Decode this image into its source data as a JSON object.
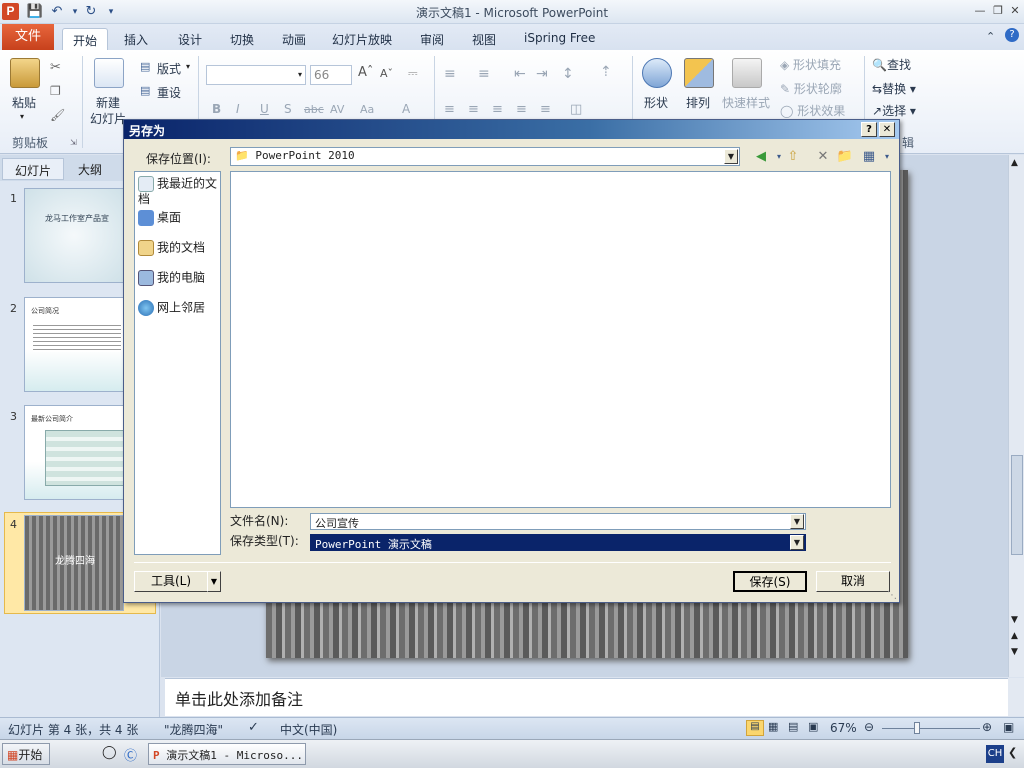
{
  "app": {
    "window_title": "演示文稿1 - Microsoft PowerPoint",
    "icon_letter": "P"
  },
  "tabs": [
    "文件",
    "开始",
    "插入",
    "设计",
    "切换",
    "动画",
    "幻灯片放映",
    "审阅",
    "视图",
    "iSpring Free"
  ],
  "ribbon": {
    "clipboard": {
      "paste": "粘贴",
      "group": "剪贴板"
    },
    "slides": {
      "new_slide_1": "新建",
      "new_slide_2": "幻灯片",
      "layout": "版式",
      "reset": "重设"
    },
    "font": {
      "font_size": "66",
      "bold": "B",
      "italic": "I",
      "underline": "U",
      "shadow": "S",
      "strike": "abc",
      "spacing": "AV",
      "case": "Aa",
      "color": "A"
    },
    "drawing": {
      "shapes": "形状",
      "arrange": "排列",
      "quick_styles": "快速样式",
      "fill": "形状填充",
      "outline": "形状轮廓",
      "effects": "形状效果"
    },
    "editing": {
      "find": "查找",
      "replace": "替换",
      "select": "选择",
      "group": "辑"
    }
  },
  "left_pane": {
    "tabs": [
      "幻灯片",
      "大纲"
    ],
    "slides": [
      {
        "number": "1",
        "text": "龙马工作室产品宣"
      },
      {
        "number": "2",
        "text": "公司简况"
      },
      {
        "number": "3",
        "text": "最新公司简介"
      },
      {
        "number": "4",
        "text": "龙腾四海"
      }
    ]
  },
  "notes_placeholder": "单击此处添加备注",
  "status": {
    "slide_info": "幻灯片 第 4 张，共 4 张",
    "theme": "\"龙腾四海\"",
    "language": "中文(中国)",
    "zoom": "67%",
    "zoom_level": 0.67
  },
  "taskbar": {
    "start": "开始",
    "task": "演示文稿1 - Microso...",
    "ime": "CH"
  },
  "dialog": {
    "title": "另存为",
    "help": "?",
    "close": "✕",
    "save_in_label": "保存位置(I):",
    "save_in_value": "PowerPoint 2010",
    "places": [
      "我最近的文档",
      "桌面",
      "我的文档",
      "我的电脑",
      "网上邻居"
    ],
    "filename_label": "文件名(N):",
    "filename_value": "公司宣传",
    "filetype_label": "保存类型(T):",
    "filetype_value": "PowerPoint 演示文稿",
    "tools_button": "工具(L)",
    "save_button": "保存(S)",
    "cancel_button": "取消"
  }
}
